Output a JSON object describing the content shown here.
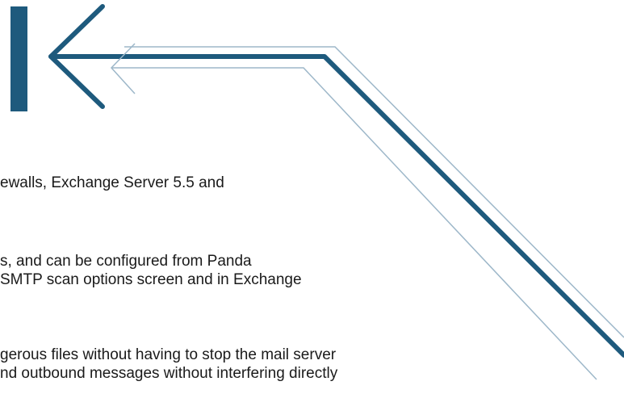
{
  "colors": {
    "primary_line": "#1e5a7d",
    "thin_line": "#9db7c9",
    "text": "#1a1a1a"
  },
  "graphic": {
    "icon": "navigate-back-arrow-icon"
  },
  "text_lines": [
    "ewalls, Exchange Server 5.5 and",
    "s, and can be configured from Panda",
    "SMTP scan options screen and in Exchange",
    "gerous files without having to stop the mail server",
    "nd outbound messages without interfering directly"
  ]
}
